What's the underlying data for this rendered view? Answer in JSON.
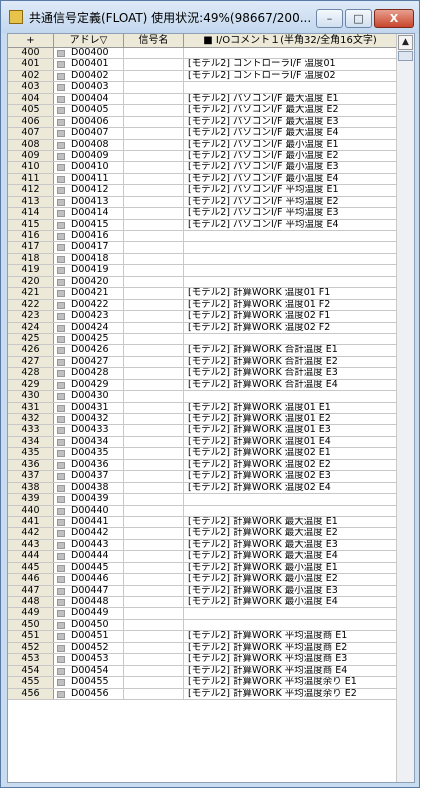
{
  "window": {
    "title": "共通信号定義(FLOAT) 使用状況:49%(98667/200...",
    "buttons": {
      "minimize": "–",
      "maximize": "□",
      "close": "X"
    }
  },
  "table": {
    "headers": [
      "+",
      "アドレ▽",
      "信号名",
      "■ I/Oコメント１(半角32/全角16文字)"
    ],
    "rows": [
      [
        "400",
        "D00400",
        ""
      ],
      [
        "401",
        "D00401",
        "[モデル2] コントローラI/F 温度01"
      ],
      [
        "402",
        "D00402",
        "[モデル2] コントローラI/F 温度02"
      ],
      [
        "403",
        "D00403",
        ""
      ],
      [
        "404",
        "D00404",
        "[モデル2] パソコンI/F 最大温度 E1"
      ],
      [
        "405",
        "D00405",
        "[モデル2] パソコンI/F 最大温度 E2"
      ],
      [
        "406",
        "D00406",
        "[モデル2] パソコンI/F 最大温度 E3"
      ],
      [
        "407",
        "D00407",
        "[モデル2] パソコンI/F 最大温度 E4"
      ],
      [
        "408",
        "D00408",
        "[モデル2] パソコンI/F 最小温度 E1"
      ],
      [
        "409",
        "D00409",
        "[モデル2] パソコンI/F 最小温度 E2"
      ],
      [
        "410",
        "D00410",
        "[モデル2] パソコンI/F 最小温度 E3"
      ],
      [
        "411",
        "D00411",
        "[モデル2] パソコンI/F 最小温度 E4"
      ],
      [
        "412",
        "D00412",
        "[モデル2] パソコンI/F 平均温度 E1"
      ],
      [
        "413",
        "D00413",
        "[モデル2] パソコンI/F 平均温度 E2"
      ],
      [
        "414",
        "D00414",
        "[モデル2] パソコンI/F 平均温度 E3"
      ],
      [
        "415",
        "D00415",
        "[モデル2] パソコンI/F 平均温度 E4"
      ],
      [
        "416",
        "D00416",
        ""
      ],
      [
        "417",
        "D00417",
        ""
      ],
      [
        "418",
        "D00418",
        ""
      ],
      [
        "419",
        "D00419",
        ""
      ],
      [
        "420",
        "D00420",
        ""
      ],
      [
        "421",
        "D00421",
        "[モデル2] 計算WORK 温度01 F1"
      ],
      [
        "422",
        "D00422",
        "[モデル2] 計算WORK 温度01 F2"
      ],
      [
        "423",
        "D00423",
        "[モデル2] 計算WORK 温度02 F1"
      ],
      [
        "424",
        "D00424",
        "[モデル2] 計算WORK 温度02 F2"
      ],
      [
        "425",
        "D00425",
        ""
      ],
      [
        "426",
        "D00426",
        "[モデル2] 計算WORK 合計温度 E1"
      ],
      [
        "427",
        "D00427",
        "[モデル2] 計算WORK 合計温度 E2"
      ],
      [
        "428",
        "D00428",
        "[モデル2] 計算WORK 合計温度 E3"
      ],
      [
        "429",
        "D00429",
        "[モデル2] 計算WORK 合計温度 E4"
      ],
      [
        "430",
        "D00430",
        ""
      ],
      [
        "431",
        "D00431",
        "[モデル2] 計算WORK 温度01 E1"
      ],
      [
        "432",
        "D00432",
        "[モデル2] 計算WORK 温度01 E2"
      ],
      [
        "433",
        "D00433",
        "[モデル2] 計算WORK 温度01 E3"
      ],
      [
        "434",
        "D00434",
        "[モデル2] 計算WORK 温度01 E4"
      ],
      [
        "435",
        "D00435",
        "[モデル2] 計算WORK 温度02 E1"
      ],
      [
        "436",
        "D00436",
        "[モデル2] 計算WORK 温度02 E2"
      ],
      [
        "437",
        "D00437",
        "[モデル2] 計算WORK 温度02 E3"
      ],
      [
        "438",
        "D00438",
        "[モデル2] 計算WORK 温度02 E4"
      ],
      [
        "439",
        "D00439",
        ""
      ],
      [
        "440",
        "D00440",
        ""
      ],
      [
        "441",
        "D00441",
        "[モデル2] 計算WORK 最大温度 E1"
      ],
      [
        "442",
        "D00442",
        "[モデル2] 計算WORK 最大温度 E2"
      ],
      [
        "443",
        "D00443",
        "[モデル2] 計算WORK 最大温度 E3"
      ],
      [
        "444",
        "D00444",
        "[モデル2] 計算WORK 最大温度 E4"
      ],
      [
        "445",
        "D00445",
        "[モデル2] 計算WORK 最小温度 E1"
      ],
      [
        "446",
        "D00446",
        "[モデル2] 計算WORK 最小温度 E2"
      ],
      [
        "447",
        "D00447",
        "[モデル2] 計算WORK 最小温度 E3"
      ],
      [
        "448",
        "D00448",
        "[モデル2] 計算WORK 最小温度 E4"
      ],
      [
        "449",
        "D00449",
        ""
      ],
      [
        "450",
        "D00450",
        ""
      ],
      [
        "451",
        "D00451",
        "[モデル2] 計算WORK 平均温度商 E1"
      ],
      [
        "452",
        "D00452",
        "[モデル2] 計算WORK 平均温度商 E2"
      ],
      [
        "453",
        "D00453",
        "[モデル2] 計算WORK 平均温度商 E3"
      ],
      [
        "454",
        "D00454",
        "[モデル2] 計算WORK 平均温度商 E4"
      ],
      [
        "455",
        "D00455",
        "[モデル2] 計算WORK 平均温度余り E1"
      ],
      [
        "456",
        "D00456",
        "[モデル2] 計算WORK 平均温度余り E2"
      ]
    ]
  },
  "scrollbar": {
    "up_arrow": "▲"
  }
}
